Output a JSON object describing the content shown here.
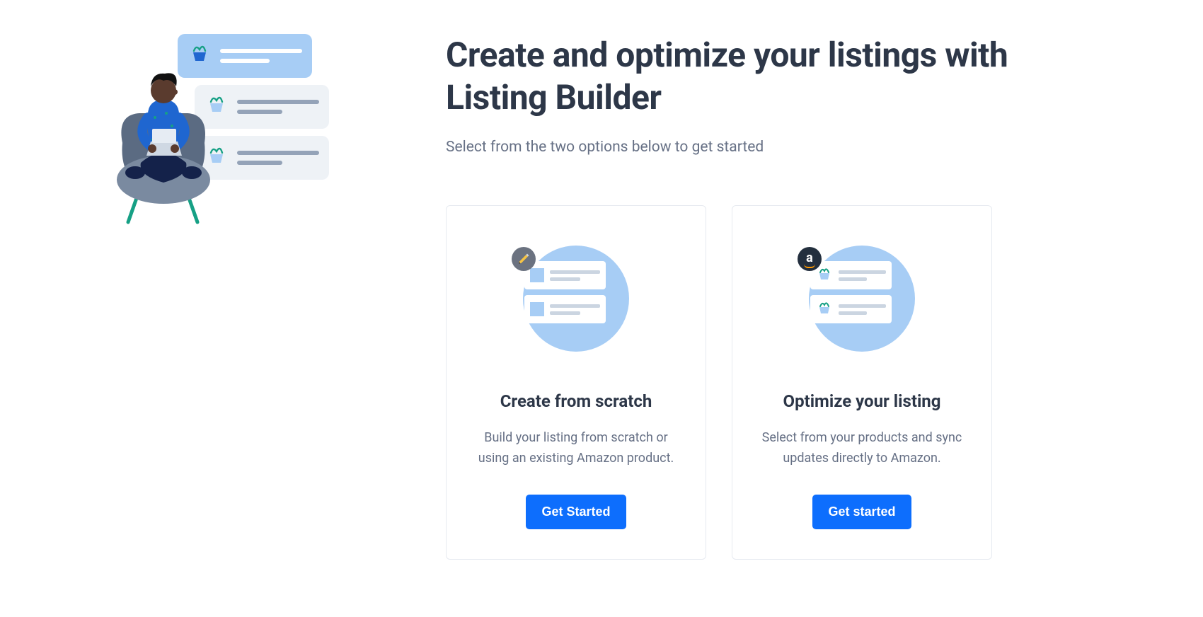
{
  "header": {
    "title": "Create and optimize your listings with Listing Builder",
    "subtitle": "Select from the two options below to get started"
  },
  "cards": {
    "scratch": {
      "title": "Create from scratch",
      "description": "Build your listing from scratch or using an existing Amazon product.",
      "button_label": "Get Started",
      "badge_icon": "pencil-icon"
    },
    "optimize": {
      "title": "Optimize your listing",
      "description": "Select from your products and sync updates directly to Amazon.",
      "button_label": "Get started",
      "badge_icon": "amazon-icon"
    }
  },
  "colors": {
    "primary": "#0d6efd",
    "illus_blue": "#a7cdf5",
    "text": "#2d3748",
    "muted": "#667085"
  }
}
